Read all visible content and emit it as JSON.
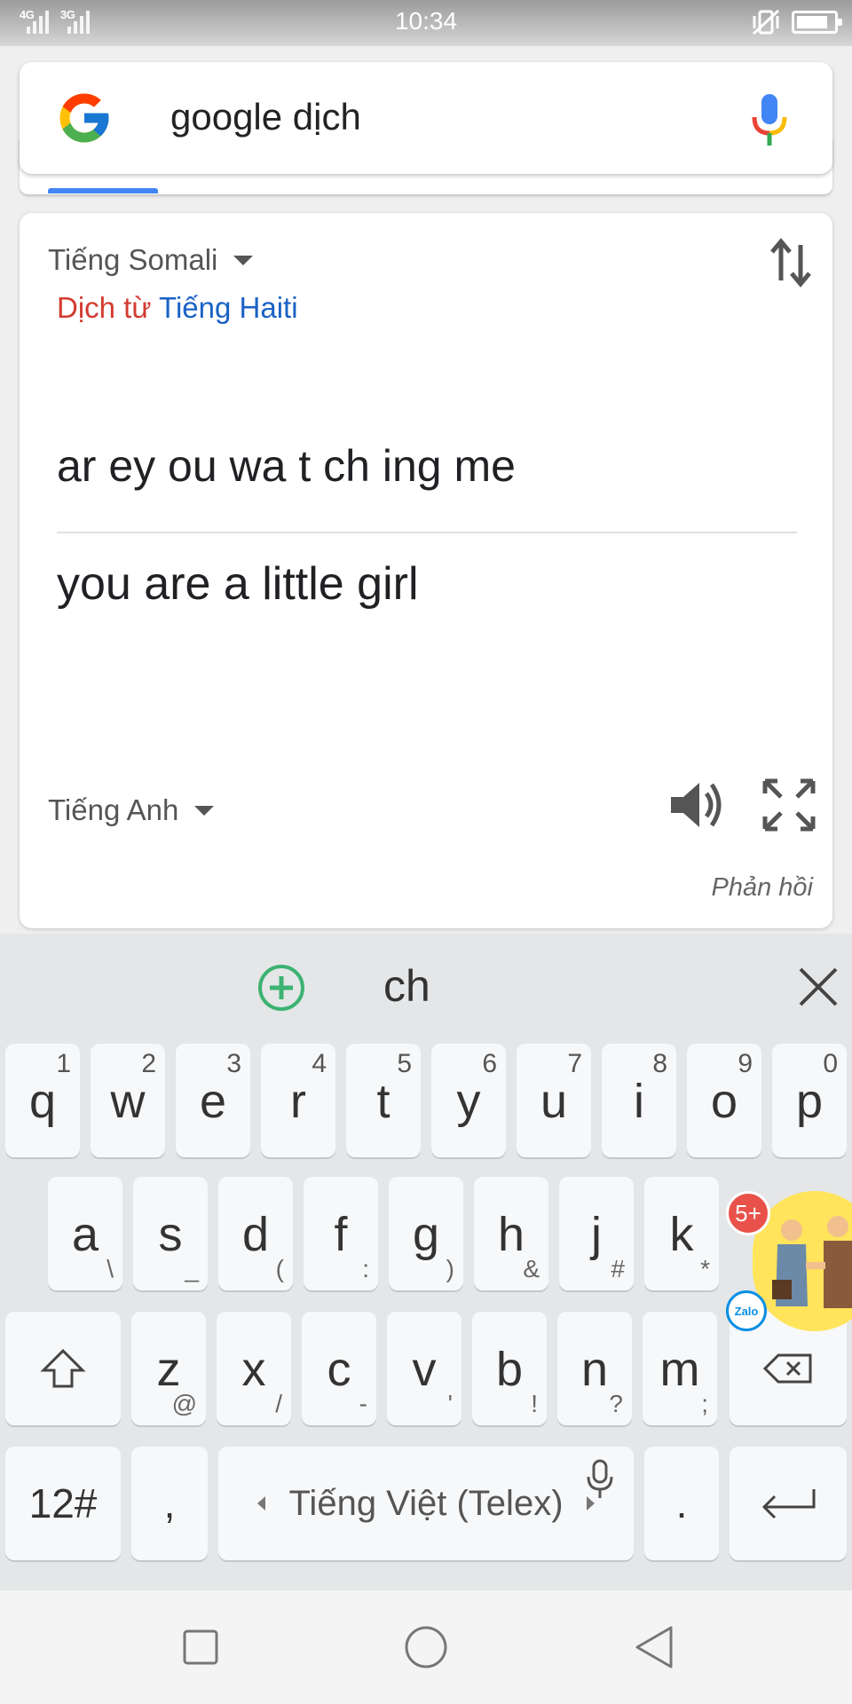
{
  "status_bar": {
    "time": "10:34",
    "network_1": "4G",
    "network_2": "3G",
    "icons": [
      "signal-icon",
      "signal-icon",
      "vibrate-mute-icon",
      "battery-icon"
    ]
  },
  "search": {
    "query": "google dịch",
    "logo": "google-g-logo",
    "mic": "mic-icon"
  },
  "translate": {
    "source_lang": "Tiếng Somali",
    "detected_prefix": "Dịch từ",
    "detected_lang": "Tiếng Haiti",
    "source_text": "ar ey ou wa t ch ing me",
    "result_text": "you are a little girl",
    "target_lang": "Tiếng Anh",
    "feedback": "Phản hồi",
    "colors": {
      "detected_prefix": "#d33b2f",
      "detected_lang": "#1a62c5",
      "accent": "#4285f4"
    }
  },
  "keyboard": {
    "suggestion": "ch",
    "row1": [
      {
        "key": "q",
        "hint": "1"
      },
      {
        "key": "w",
        "hint": "2"
      },
      {
        "key": "e",
        "hint": "3"
      },
      {
        "key": "r",
        "hint": "4"
      },
      {
        "key": "t",
        "hint": "5"
      },
      {
        "key": "y",
        "hint": "6"
      },
      {
        "key": "u",
        "hint": "7"
      },
      {
        "key": "i",
        "hint": "8"
      },
      {
        "key": "o",
        "hint": "9"
      },
      {
        "key": "p",
        "hint": "0"
      }
    ],
    "row2": [
      {
        "key": "a",
        "sub": "\\"
      },
      {
        "key": "s",
        "sub": "_"
      },
      {
        "key": "d",
        "sub": "("
      },
      {
        "key": "f",
        "sub": ":"
      },
      {
        "key": "g",
        "sub": ")"
      },
      {
        "key": "h",
        "sub": "&"
      },
      {
        "key": "j",
        "sub": "#"
      },
      {
        "key": "k",
        "sub": "*"
      }
    ],
    "row3": [
      {
        "key": "z",
        "sub": "@"
      },
      {
        "key": "x",
        "sub": "/"
      },
      {
        "key": "c",
        "sub": "-"
      },
      {
        "key": "v",
        "sub": "'"
      },
      {
        "key": "b",
        "sub": "!"
      },
      {
        "key": "n",
        "sub": "?"
      },
      {
        "key": "m",
        "sub": ";"
      }
    ],
    "symbols_key": "12#",
    "comma_key": ",",
    "space_label": "Tiếng Việt (Telex)",
    "period_key": "."
  },
  "zalo": {
    "badge": "5+",
    "logo_text": "Zalo"
  }
}
